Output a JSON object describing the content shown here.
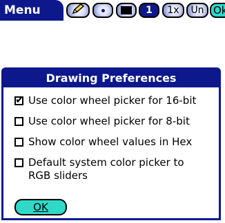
{
  "menubar": {
    "menu_label": "Menu",
    "tools": {
      "pencil": "pencil-icon",
      "dot": "dot-icon",
      "color": "black-swatch",
      "number": "1",
      "zoom": "1x",
      "undo": "Un",
      "ok": "Ok"
    }
  },
  "dialog": {
    "title": "Drawing Preferences",
    "options": [
      {
        "label": "Use color wheel picker for 16-bit",
        "checked": true
      },
      {
        "label": "Use color wheel picker for 8-bit",
        "checked": false
      },
      {
        "label": "Show color wheel values in Hex",
        "checked": false
      },
      {
        "label": "Default system color picker to RGB sliders",
        "checked": false
      }
    ],
    "ok_label": "OK"
  },
  "colors": {
    "title_bar": "#0c188c",
    "button_fill": "#30d8c8"
  }
}
